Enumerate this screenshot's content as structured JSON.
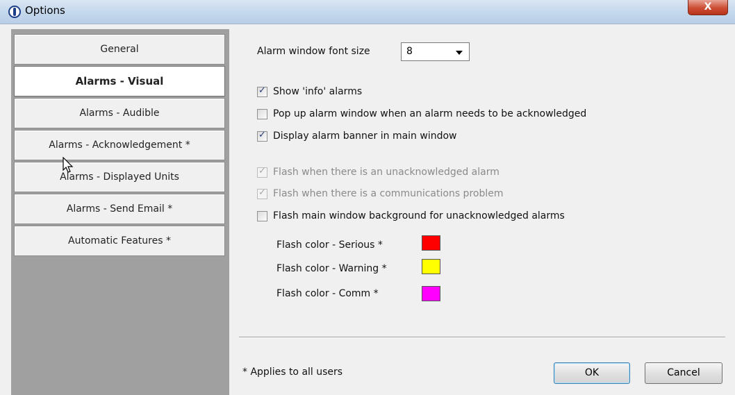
{
  "window": {
    "title": "Options",
    "close_label": "X"
  },
  "nav": {
    "items": [
      {
        "label": "General",
        "active": false
      },
      {
        "label": "Alarms - Visual",
        "active": true
      },
      {
        "label": "Alarms - Audible",
        "active": false
      },
      {
        "label": "Alarms - Acknowledgement *",
        "active": false
      },
      {
        "label": "Alarms - Displayed Units",
        "active": false
      },
      {
        "label": "Alarms - Send Email *",
        "active": false
      },
      {
        "label": "Automatic Features *",
        "active": false
      }
    ]
  },
  "font_size": {
    "label": "Alarm window font size",
    "value": "8"
  },
  "checkboxes": [
    {
      "label": "Show 'info' alarms",
      "checked": true,
      "enabled": true
    },
    {
      "label": "Pop up alarm window when an alarm needs to be acknowledged",
      "checked": false,
      "enabled": true
    },
    {
      "label": "Display alarm banner in main window",
      "checked": true,
      "enabled": true
    },
    {
      "label": "Flash when there is an unacknowledged alarm",
      "checked": true,
      "enabled": false
    },
    {
      "label": "Flash when there is a communications problem",
      "checked": true,
      "enabled": false
    },
    {
      "label": "Flash main window background for unacknowledged alarms",
      "checked": false,
      "enabled": true
    }
  ],
  "flash_colors": [
    {
      "label": "Flash color - Serious *",
      "color": "#ff0000"
    },
    {
      "label": "Flash color - Warning *",
      "color": "#ffff00"
    },
    {
      "label": "Flash color - Comm *",
      "color": "#ff00ff"
    }
  ],
  "footer": {
    "note": "* Applies to all users",
    "ok_label": "OK",
    "cancel_label": "Cancel"
  }
}
